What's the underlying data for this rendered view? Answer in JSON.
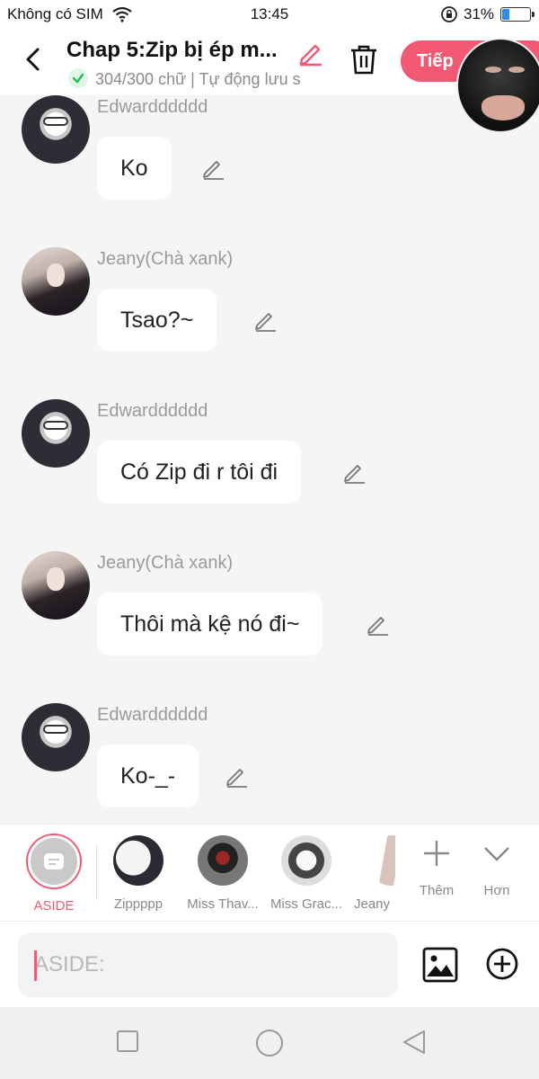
{
  "status_bar": {
    "carrier": "Không có SIM",
    "time": "13:45",
    "battery_percent": "31%",
    "battery_level": 0.31
  },
  "header": {
    "title": "Chap 5:Zip bị ép m...",
    "save_status": "304/300 chữ | Tự động lưu s",
    "next_label": "Tiếp",
    "accent_color": "#f25a74"
  },
  "messages": [
    {
      "name": "Edwardddddd",
      "text": "Ko",
      "avatar": "edward"
    },
    {
      "name": "Jeany(Chà xank)",
      "text": "Tsao?~",
      "avatar": "jeany"
    },
    {
      "name": "Edwardddddd",
      "text": "Có Zip đi r tôi đi",
      "avatar": "edward"
    },
    {
      "name": "Jeany(Chà xank)",
      "text": "Thôi mà kệ nó đi~",
      "avatar": "jeany"
    },
    {
      "name": "Edwardddddd",
      "text": "Ko-_-",
      "avatar": "edward"
    }
  ],
  "characters": {
    "aside": "ASIDE",
    "list": [
      "Zippppp",
      "Miss Thav...",
      "Miss Grac...",
      "Jeany"
    ],
    "more_label": "Thêm",
    "expand_label": "Hơn"
  },
  "input": {
    "placeholder": "ASIDE:"
  },
  "icons": [
    "back-arrow-icon",
    "pencil-icon",
    "trash-icon",
    "check-icon",
    "image-icon",
    "plus-circle-icon",
    "plus-icon",
    "chevron-down-icon",
    "square-icon",
    "circle-icon",
    "triangle-back-icon"
  ]
}
